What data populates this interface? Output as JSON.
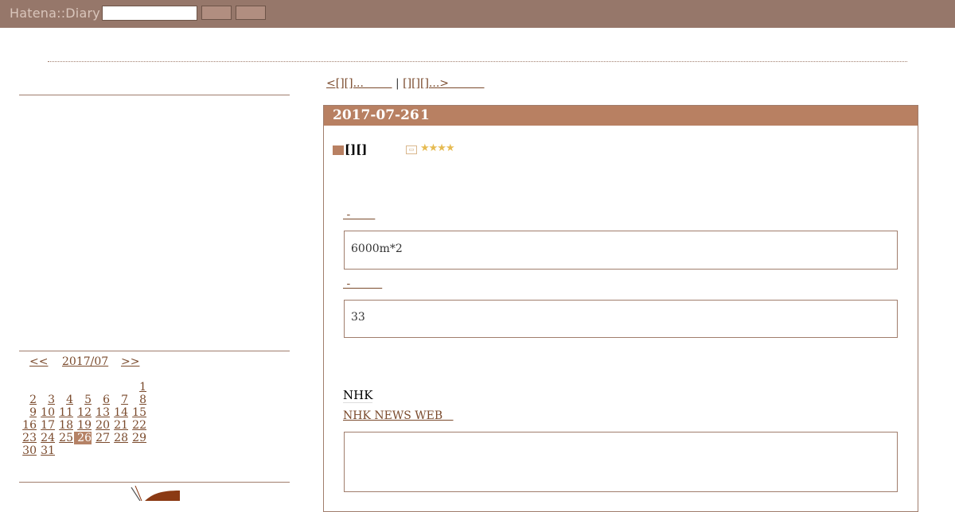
{
  "topbar": {
    "logo": "Hatena::Diary",
    "search_input_value": "",
    "button1_label": "",
    "button2_label": ""
  },
  "pager": {
    "prev_label": "<[][]...        ",
    "separator": " | ",
    "next_label": "[][][]...>          "
  },
  "calendar": {
    "prev": "<<",
    "month": "2017/07",
    "next": ">>",
    "selected_day": "26",
    "days": [
      "1",
      "2",
      "3",
      "4",
      "5",
      "6",
      "7",
      "8",
      "9",
      "10",
      "11",
      "12",
      "13",
      "14",
      "15",
      "16",
      "17",
      "18",
      "19",
      "20",
      "21",
      "22",
      "23",
      "24",
      "25",
      "26",
      "27",
      "28",
      "29",
      "30",
      "31"
    ]
  },
  "entry": {
    "date": "2017-07-26",
    "count": "1",
    "section_title": "[][]",
    "rating_stars": "★★★★",
    "link1_label": " -       ",
    "quote1": "6000m*2",
    "link2_label": " -         ",
    "quote2": "33",
    "source_label": "NHK",
    "source_link": "NHK NEWS WEB   ",
    "quote3": ""
  },
  "colors": {
    "topbar": "#96776a",
    "accent": "#b88062",
    "link": "#7a4a2c",
    "star": "#e6bb52"
  },
  "icons": {
    "section_marker": "square-marker-icon",
    "image_icon": "image-icon",
    "rating": "star-rating-icon"
  }
}
